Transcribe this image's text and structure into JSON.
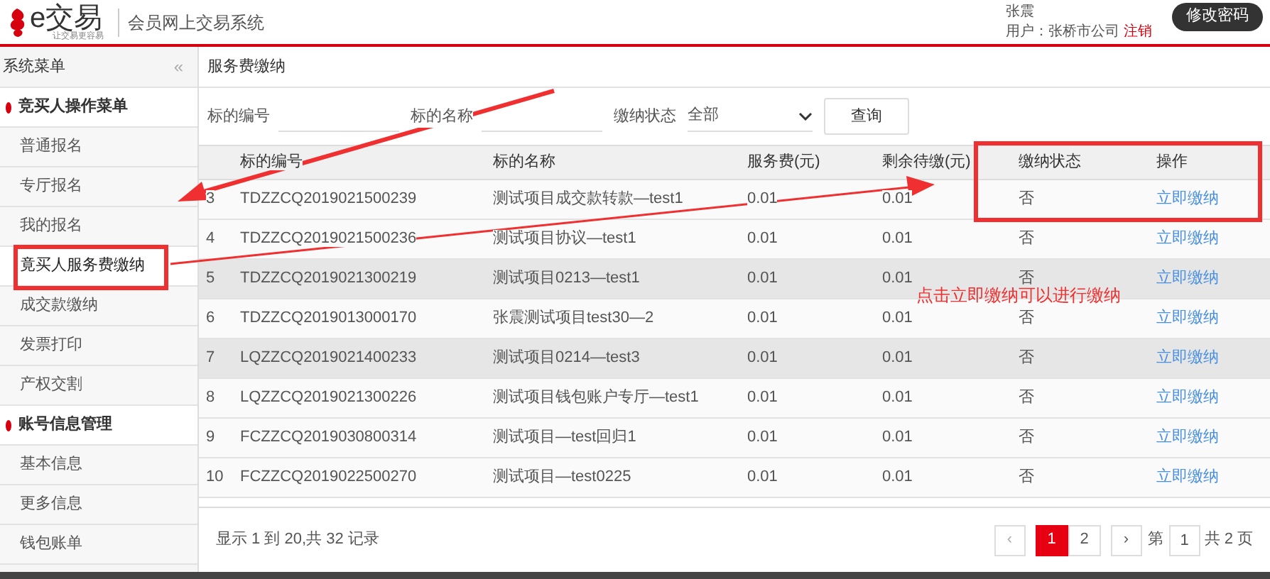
{
  "header": {
    "logo_text": "e交易",
    "logo_slogan": "让交易更容易",
    "system_title": "会员网上交易系统",
    "user_name": "张震",
    "user_label": "用户：张桥市公司",
    "logout": "注销",
    "change_password": "修改密码"
  },
  "sidebar": {
    "title": "系统菜单",
    "collapse": "«",
    "sections": [
      {
        "label": "竞买人操作菜单",
        "items": [
          {
            "label": "普通报名",
            "selected": false
          },
          {
            "label": "专厅报名",
            "selected": false
          },
          {
            "label": "我的报名",
            "selected": false
          },
          {
            "label": "竟买人服务费缴纳",
            "selected": true
          },
          {
            "label": "成交款缴纳",
            "selected": false
          },
          {
            "label": "发票打印",
            "selected": false
          },
          {
            "label": "产权交割",
            "selected": false
          }
        ]
      },
      {
        "label": "账号信息管理",
        "items": [
          {
            "label": "基本信息",
            "selected": false
          },
          {
            "label": "更多信息",
            "selected": false
          },
          {
            "label": "钱包账单",
            "selected": false
          }
        ]
      }
    ]
  },
  "page_title": "服务费缴纳",
  "filters": {
    "code_label": "标的编号",
    "name_label": "标的名称",
    "status_label": "缴纳状态",
    "status_value": "全部",
    "query_button": "查询"
  },
  "table": {
    "columns": [
      "",
      "标的编号",
      "标的名称",
      "服务费(元)",
      "剩余待缴(元)",
      "缴纳状态",
      "操作"
    ],
    "rows": [
      {
        "index": "3",
        "code": "TDZZCQ2019021500239",
        "name": "测试项目成交款转款—test1",
        "fee": "0.01",
        "remaining": "0.01",
        "status": "否",
        "action": "立即缴纳",
        "highlighted": false
      },
      {
        "index": "4",
        "code": "TDZZCQ2019021500236",
        "name": "测试项目协议—test1",
        "fee": "0.01",
        "remaining": "0.01",
        "status": "否",
        "action": "立即缴纳",
        "highlighted": false
      },
      {
        "index": "5",
        "code": "TDZZCQ2019021300219",
        "name": "测试项目0213—test1",
        "fee": "0.01",
        "remaining": "0.01",
        "status": "否",
        "action": "立即缴纳",
        "highlighted": true
      },
      {
        "index": "6",
        "code": "TDZZCQ2019013000170",
        "name": "张震测试项目test30—2",
        "fee": "0.01",
        "remaining": "0.01",
        "status": "否",
        "action": "立即缴纳",
        "highlighted": false
      },
      {
        "index": "7",
        "code": "LQZZCQ2019021400233",
        "name": "测试项目0214—test3",
        "fee": "0.01",
        "remaining": "0.01",
        "status": "否",
        "action": "立即缴纳",
        "highlighted": true
      },
      {
        "index": "8",
        "code": "LQZZCQ2019021300226",
        "name": "测试项目钱包账户专厅—test1",
        "fee": "0.01",
        "remaining": "0.01",
        "status": "否",
        "action": "立即缴纳",
        "highlighted": false
      },
      {
        "index": "9",
        "code": "FCZZCQ2019030800314",
        "name": "测试项目—test回归1",
        "fee": "0.01",
        "remaining": "0.01",
        "status": "否",
        "action": "立即缴纳",
        "highlighted": false
      },
      {
        "index": "10",
        "code": "FCZZCQ2019022500270",
        "name": "测试项目—test0225",
        "fee": "0.01",
        "remaining": "0.01",
        "status": "否",
        "action": "立即缴纳",
        "highlighted": false
      }
    ]
  },
  "footer": {
    "summary": "显示 1 到 20,共 32 记录",
    "prev": "‹",
    "pages": [
      {
        "label": "1",
        "selected": true
      },
      {
        "label": "2",
        "selected": false
      }
    ],
    "next": "›",
    "page_prefix": "第",
    "page_input": "1",
    "page_total": "共 2 页"
  },
  "annotation": {
    "note": "点击立即缴纳可以进行缴纳"
  }
}
